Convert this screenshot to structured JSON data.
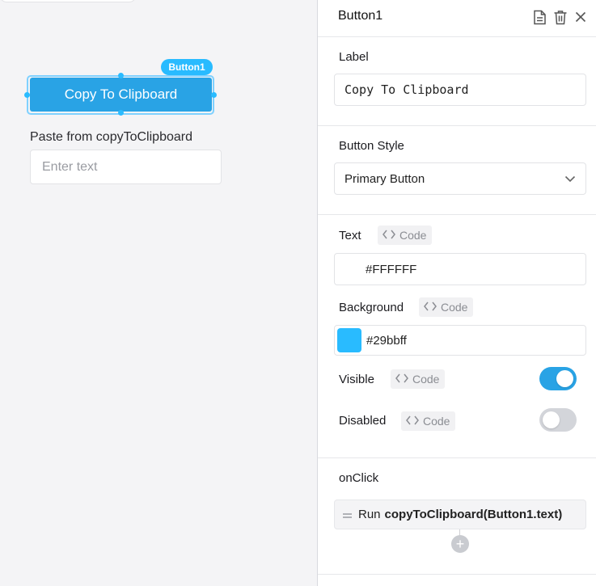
{
  "canvas": {
    "widget_tag": "Button1",
    "button_label": "Copy To Clipboard",
    "paste_label": "Paste from copyToClipboard",
    "paste_placeholder": "Enter text"
  },
  "panel": {
    "title": "Button1",
    "label_section": {
      "label": "Label",
      "value": "Copy To Clipboard"
    },
    "button_style": {
      "label": "Button Style",
      "value": "Primary Button"
    },
    "text_color": {
      "label": "Text",
      "code_label": "Code",
      "value": "#FFFFFF"
    },
    "background": {
      "label": "Background",
      "code_label": "Code",
      "value": "#29bbff",
      "swatch_color": "#29bbff"
    },
    "visible": {
      "label": "Visible",
      "code_label": "Code",
      "on": true
    },
    "disabled": {
      "label": "Disabled",
      "code_label": "Code",
      "on": false
    },
    "onclick": {
      "label": "onClick",
      "action_prefix": "Run",
      "action_call": "copyToClipboard(Button1.text)"
    }
  },
  "colors": {
    "accent": "#29bbff",
    "button_bg": "#29a3e5"
  }
}
